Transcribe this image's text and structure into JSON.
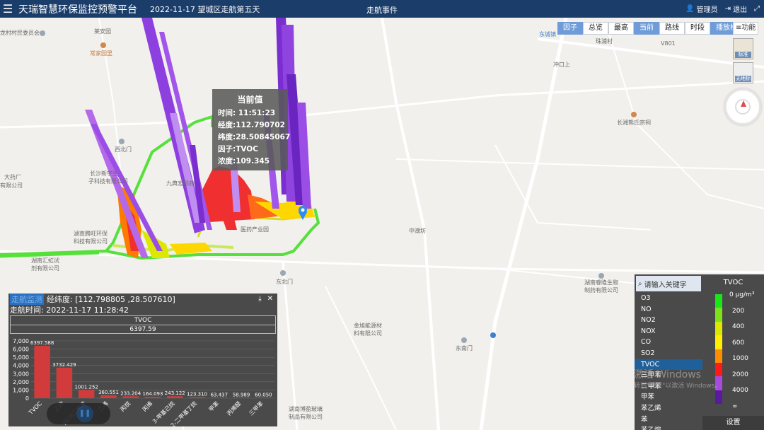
{
  "header": {
    "title": "天瑞智慧环保监控预警平台",
    "date": "2022-11-17 望城区走航第五天",
    "event": "走航事件",
    "user": "管理员",
    "logout": "退出"
  },
  "toolbar": {
    "buttons": [
      "因子",
      "总览",
      "最高",
      "当前",
      "路线",
      "时段",
      "播放栏"
    ],
    "func": "功能",
    "maptypes": [
      "标准",
      "无地标"
    ]
  },
  "map_labels": {
    "l1": "龙村村民委员会",
    "l2": "莱安园",
    "l3": "常家园里",
    "l4": "西北门",
    "l5": "东城镇",
    "l6": "珠浦村",
    "l7": "长沙新宇生",
    "l8": "子科技有限公司",
    "l9": "九典宏阳药",
    "l10": "湖南腾旺环保",
    "l11": "科技有限公司",
    "l12": "湖南汇虹试",
    "l13": "剂有限公司",
    "l14": "医药产业园",
    "l15": "东北门",
    "l16": "中潮坊",
    "l17": "长湘熊氏宗祠",
    "l18": "湖南睿隆生物",
    "l19": "制药有限公司",
    "l20": "金旭能源材",
    "l21": "料有限公司",
    "l22": "东南门",
    "l23": "湖南博盈玻璃",
    "l24": "制品有限公司",
    "l25": "冲口上",
    "l26": "大药厂",
    "l27": "有限公司",
    "l28": "V801"
  },
  "tooltip": {
    "title": "当前值",
    "time": "时间: 11:51:23",
    "lng": "经度:112.790702",
    "lat": "纬度:28.50845067",
    "factor": "因子:TVOC",
    "conc": "浓度:109.345"
  },
  "panel": {
    "title": "走航监测",
    "coords": "经纬度: [112.798805 ,28.507610]",
    "time": "走航时间: 2022-11-17 11:28:42",
    "factor": "TVOC",
    "value": "6397.59"
  },
  "chart_data": {
    "type": "bar",
    "categories": [
      "TVOC",
      "乙烷",
      "间/对二甲苯",
      "乙烯",
      "丙烷",
      "丙烯",
      "3-甲基己烷",
      "2,2-二甲基丁烷",
      "甲苯",
      "丙烯醛",
      "三甲苯"
    ],
    "values": [
      6397.588,
      3732.429,
      1001.252,
      360.551,
      233.204,
      164.093,
      243.122,
      123.31,
      63.437,
      58.989,
      60.05
    ],
    "value_labels": [
      "6397.588",
      "3732.429",
      "1001.252",
      "360.551",
      "233.204",
      "164.093",
      "243.122",
      "123.310",
      "63.437",
      "58.989",
      "60.050"
    ],
    "yticks": [
      "0",
      "1,000",
      "2,000",
      "3,000",
      "4,000",
      "5,000",
      "6,000",
      "7,000"
    ],
    "ylim": [
      0,
      7000
    ],
    "bar_color": "#d23b3b"
  },
  "factor_list": {
    "search_placeholder": "请输入关键字",
    "items": [
      "O3",
      "NO",
      "NO2",
      "NOX",
      "CO",
      "SO2",
      "TVOC",
      "三甲苯",
      "二甲苯",
      "甲苯",
      "苯乙烯",
      "苯",
      "苯乙烷"
    ],
    "active_index": 6
  },
  "legend": {
    "title": "TVOC",
    "labels": [
      "0 μg/m³",
      "200",
      "400",
      "600",
      "1000",
      "2000",
      "4000",
      "∞"
    ],
    "colors": [
      "#19e619",
      "#7de21a",
      "#dde800",
      "#ffee00",
      "#ff8c00",
      "#ff1a1a",
      "#a64ae0",
      "#5a1a9e"
    ],
    "setup": "设置"
  },
  "watermark": {
    "line1": "激活 Windows",
    "line2": "转到\"设置\"以激活 Windows。"
  }
}
